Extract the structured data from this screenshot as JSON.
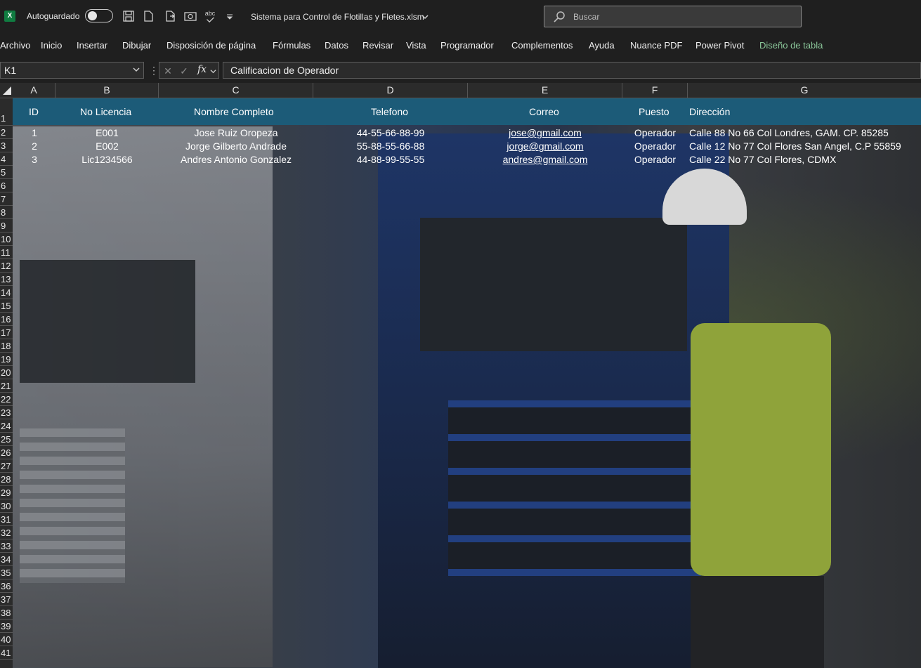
{
  "titlebar": {
    "autosave_label": "Autoguardado",
    "file_title": "Sistema para Control de Flotillas y Fletes.xlsm",
    "search_placeholder": "Buscar",
    "spell_icon_text": "abc"
  },
  "menu": {
    "items": [
      "Archivo",
      "Inicio",
      "Insertar",
      "Dibujar",
      "Disposición de página",
      "Fórmulas",
      "Datos",
      "Revisar",
      "Vista",
      "Programador",
      "Complementos",
      "Ayuda",
      "Nuance PDF",
      "Power Pivot",
      "Diseño de tabla"
    ],
    "accent_color": "#8bc79a"
  },
  "formula_bar": {
    "name_box": "K1",
    "fx_label": "fx",
    "formula": "Calificacion de Operador"
  },
  "columns": [
    "A",
    "B",
    "C",
    "D",
    "E",
    "F",
    "G"
  ],
  "rows": [
    "1",
    "2",
    "3",
    "4",
    "5",
    "6",
    "7",
    "8",
    "9",
    "10",
    "11",
    "12",
    "13",
    "14",
    "15",
    "16",
    "17",
    "18",
    "19",
    "20",
    "21",
    "22",
    "23",
    "24",
    "25",
    "26",
    "27",
    "28",
    "29",
    "30",
    "31",
    "32",
    "33",
    "34",
    "35",
    "36",
    "37",
    "38",
    "39",
    "40",
    "41"
  ],
  "table": {
    "header_color": "#1c5b78",
    "headers": [
      "ID",
      "No Licencia",
      "Nombre Completo",
      "Telefono",
      "Correo",
      "Puesto",
      "Dirección"
    ],
    "rows": [
      {
        "id": "1",
        "licencia": "E001",
        "nombre": "Jose Ruiz Oropeza",
        "telefono": "44-55-66-88-99",
        "correo": "jose@gmail.com",
        "puesto": "Operador",
        "direccion": "Calle 88 No 66 Col Londres, GAM. CP. 85285"
      },
      {
        "id": "2",
        "licencia": "E002",
        "nombre": "Jorge Gilberto Andrade",
        "telefono": "55-88-55-66-88",
        "correo": "jorge@gmail.com",
        "puesto": "Operador",
        "direccion": "Calle 12 No 77 Col Flores San Angel, C.P 55859"
      },
      {
        "id": "3",
        "licencia": "Lic1234566",
        "nombre": "Andres Antonio Gonzalez",
        "telefono": "44-88-99-55-55",
        "correo": "andres@gmail.com",
        "puesto": "Operador",
        "direccion": "Calle 22 No 77 Col Flores, CDMX"
      }
    ]
  }
}
